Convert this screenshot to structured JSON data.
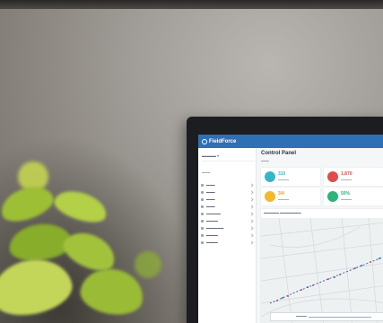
{
  "colors": {
    "accent": "#2f6fb6",
    "stat_teal": "#35b7c9",
    "stat_red": "#e04c4c",
    "stat_yellow": "#f2b92e",
    "stat_green": "#2cb47a",
    "plant_green": "#a8c441"
  },
  "app": {
    "brand": "FieldForce",
    "page_title": "Control Panel"
  },
  "stats": [
    {
      "value": "310"
    },
    {
      "value": "1,870"
    },
    {
      "value": "3/4"
    },
    {
      "value": "50%"
    }
  ],
  "icons": {
    "brand": "globe-icon",
    "nav": "menu-item-icon",
    "chevron": "chevron-right-icon"
  }
}
